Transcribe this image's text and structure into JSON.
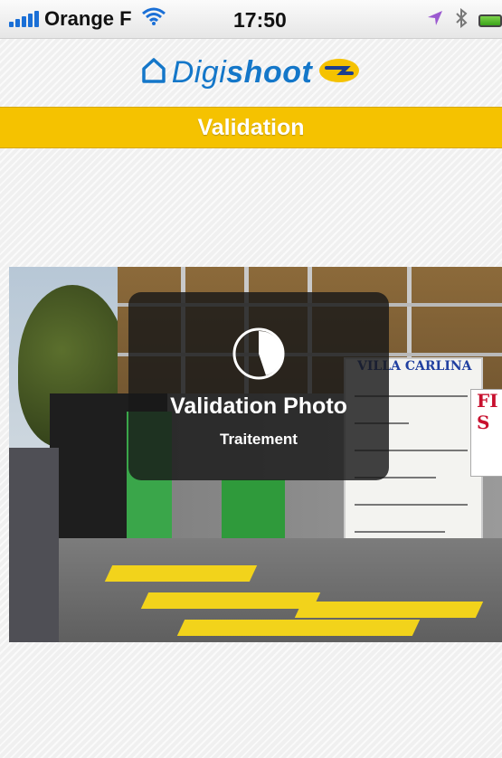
{
  "status_bar": {
    "carrier": "Orange F",
    "time": "17:50"
  },
  "header": {
    "logo_part1": "Digi",
    "logo_part2": "shoot"
  },
  "title_bar": {
    "title": "Validation"
  },
  "hud": {
    "title": "Validation Photo",
    "subtitle": "Traitement",
    "icon": "progress-pie-icon"
  },
  "photo": {
    "board_title": "VILLA CARLINA",
    "sign_text_1": "FI",
    "sign_text_2": "S"
  },
  "colors": {
    "title_bar_bg": "#f5c200",
    "logo_blue": "#1477c9",
    "hud_bg": "#191919"
  }
}
